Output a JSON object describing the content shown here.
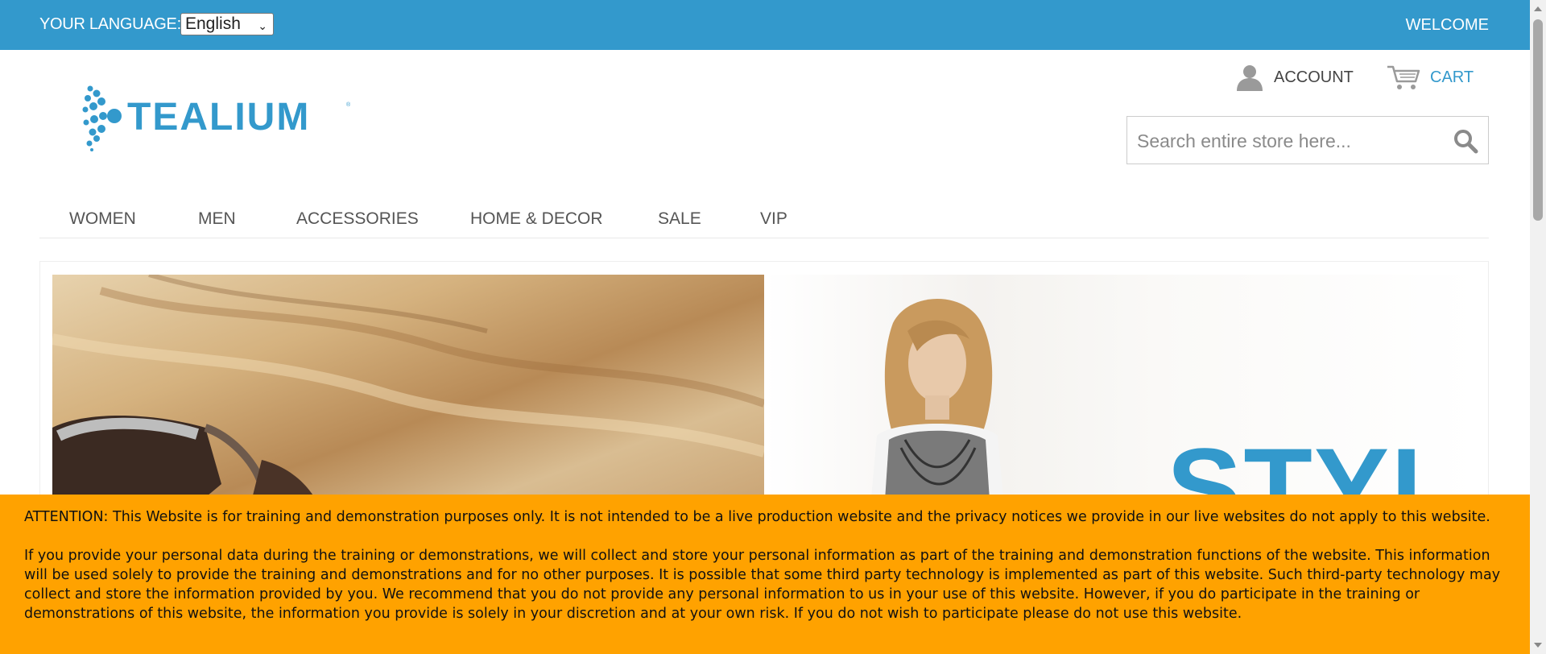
{
  "topbar": {
    "language_label": "YOUR LANGUAGE:",
    "language_selected": "English",
    "welcome": "WELCOME",
    "background_color": "#3399cc"
  },
  "header": {
    "logo_text": "TEALIUM",
    "account_label": "ACCOUNT",
    "account_icon": "user-icon",
    "cart_label": "CART",
    "cart_icon": "cart-icon",
    "search_placeholder": "Search entire store here...",
    "search_icon": "search-icon"
  },
  "nav": {
    "items": [
      {
        "label": "WOMEN"
      },
      {
        "label": "MEN"
      },
      {
        "label": "ACCESSORIES"
      },
      {
        "label": "HOME & DECOR"
      },
      {
        "label": "SALE"
      },
      {
        "label": "VIP"
      }
    ]
  },
  "banner": {
    "right_text": "STYL"
  },
  "attention": {
    "paragraph1": "ATTENTION: This Website is for training and demonstration purposes only. It is not intended to be a live production website and the privacy notices we provide in our live websites do not apply to this website.",
    "paragraph2": "If you provide your personal data during the training or demonstrations, we will collect and store your personal information as part of the training and demonstration functions of the website. This information will be used solely to provide the training and demonstrations and for no other purposes. It is possible that some third party technology is implemented as part of this website. Such third-party technology may collect and store the information provided by you. We recommend that you do not provide any personal information to us in your use of this website. However, if you do participate in the training or demonstrations of this website, the information you provide is solely in your discretion and at your own risk. If you do not wish to participate please do not use this website.",
    "background_color": "#ffa200"
  },
  "colors": {
    "accent": "#3399cc",
    "notice": "#ffa200"
  }
}
